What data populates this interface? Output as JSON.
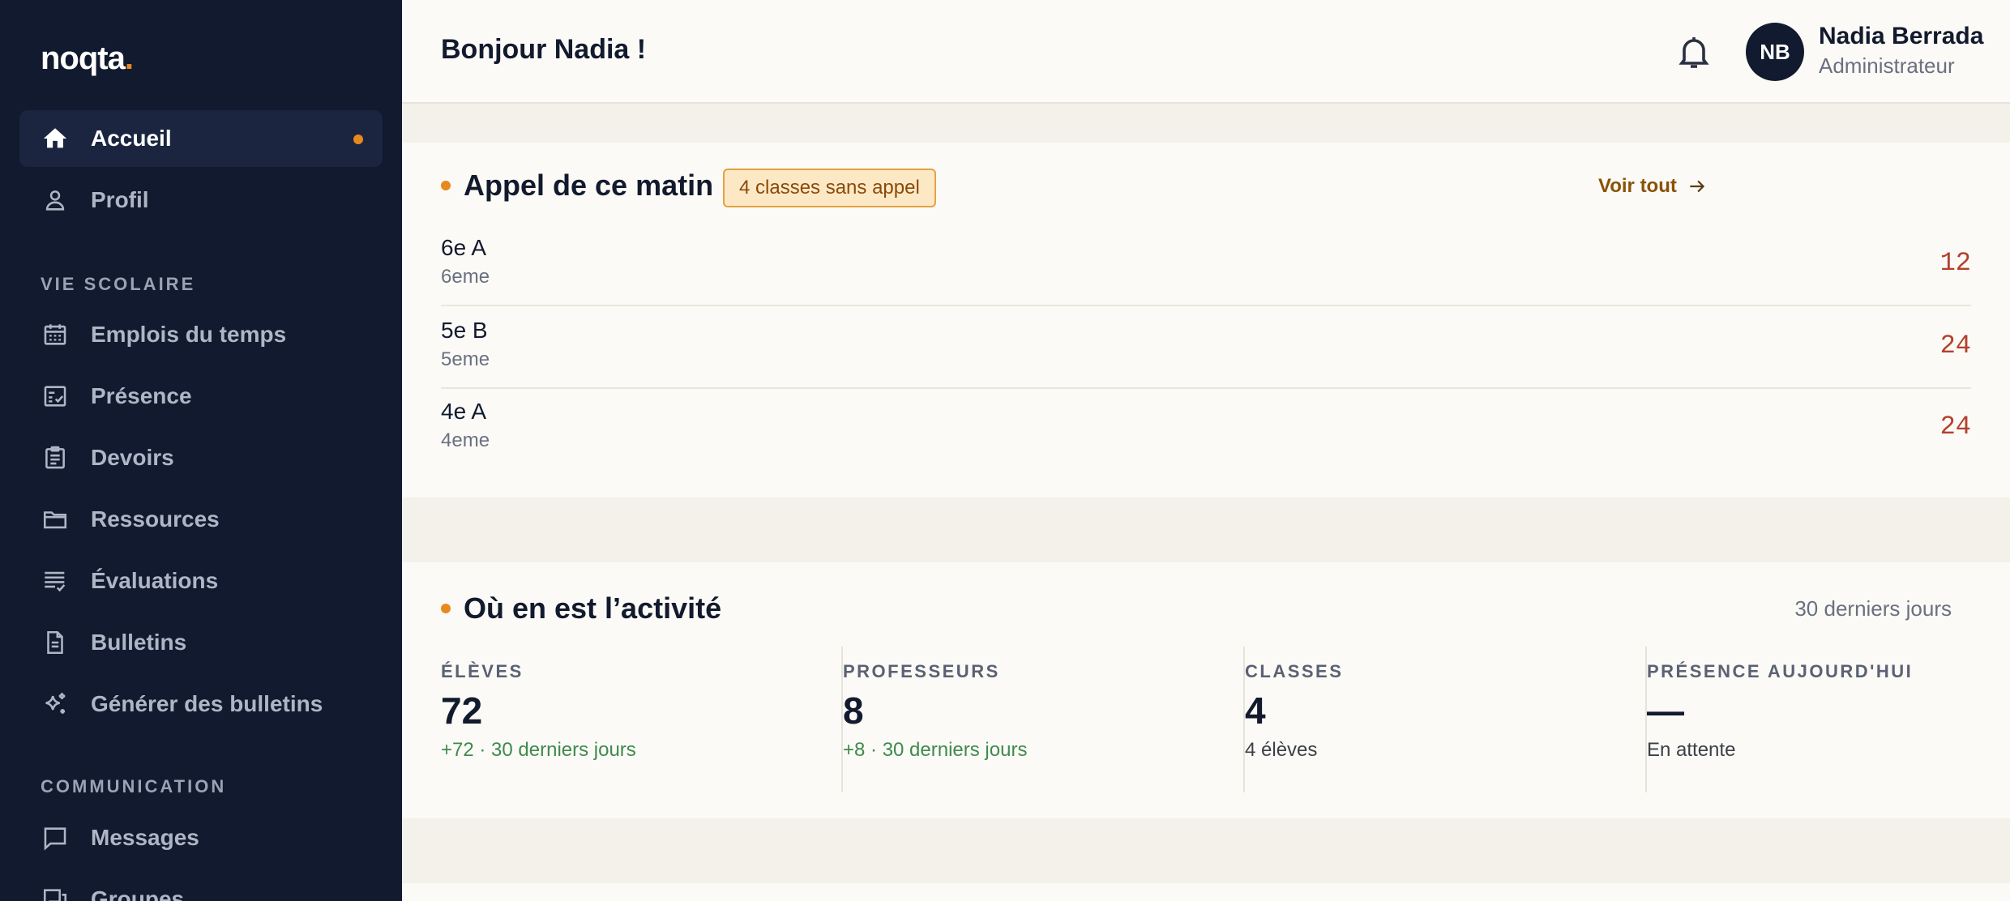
{
  "app": {
    "logo_text": "noqta",
    "logo_dot": "."
  },
  "sidebar": {
    "items": [
      {
        "label": "Accueil",
        "icon": "home-icon",
        "active": true
      },
      {
        "label": "Profil",
        "icon": "person-icon"
      }
    ],
    "sections": [
      {
        "title": "VIE SCOLAIRE",
        "items": [
          {
            "label": "Emplois du temps",
            "icon": "calendar-icon"
          },
          {
            "label": "Présence",
            "icon": "checklist-icon"
          },
          {
            "label": "Devoirs",
            "icon": "clipboard-icon"
          },
          {
            "label": "Ressources",
            "icon": "folder-icon"
          },
          {
            "label": "Évaluations",
            "icon": "list-check-icon"
          },
          {
            "label": "Bulletins",
            "icon": "document-icon"
          },
          {
            "label": "Générer des bulletins",
            "icon": "sparkle-icon"
          }
        ]
      },
      {
        "title": "COMMUNICATION",
        "items": [
          {
            "label": "Messages",
            "icon": "chat-icon"
          },
          {
            "label": "Groupes",
            "icon": "groups-icon"
          }
        ]
      }
    ]
  },
  "header": {
    "greeting": "Bonjour Nadia !",
    "avatar_initials": "NB",
    "user_name": "Nadia Berrada",
    "user_role": "Administrateur"
  },
  "appel": {
    "title": "Appel de ce matin",
    "tag": "4 classes sans appel",
    "voir_tout": "Voir tout",
    "rows": [
      {
        "name": "6e A",
        "level": "6eme",
        "count": "12"
      },
      {
        "name": "5e B",
        "level": "5eme",
        "count": "24"
      },
      {
        "name": "4e A",
        "level": "4eme",
        "count": "24"
      }
    ]
  },
  "activite": {
    "title": "Où en est l’activité",
    "period": "30 derniers jours",
    "stats": [
      {
        "label": "ÉLÈVES",
        "value": "72",
        "sub": "+72 · 30 derniers jours",
        "positive": true
      },
      {
        "label": "PROFESSEURS",
        "value": "8",
        "sub": "+8 · 30 derniers jours",
        "positive": true
      },
      {
        "label": "CLASSES",
        "value": "4",
        "sub": "4 élèves",
        "positive": false
      },
      {
        "label": "PRÉSENCE AUJOURD'HUI",
        "value": "—",
        "sub": "En attente",
        "positive": false
      }
    ]
  },
  "colors": {
    "sidebar_bg": "#111a2e",
    "accent": "#e8891d",
    "count_red": "#b4402c",
    "positive_green": "#3f8a4e"
  }
}
